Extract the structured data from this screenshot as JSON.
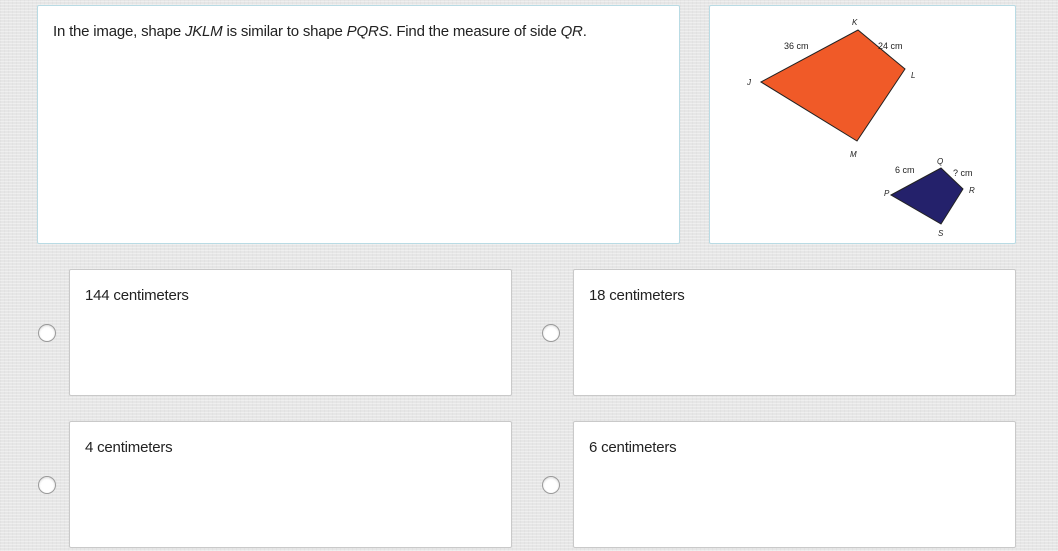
{
  "question": {
    "prefix": "In the image, shape ",
    "shape1": "JKLM",
    "middle": " is similar to shape ",
    "shape2": "PQRS",
    "suffix": ". Find the measure of side ",
    "side": "QR",
    "end": "."
  },
  "figure": {
    "large_shape": {
      "fill": "#f05a28",
      "vertices": {
        "J": "J",
        "K": "K",
        "L": "L",
        "M": "M"
      },
      "side_jk": "36 cm",
      "side_kl": "24 cm"
    },
    "small_shape": {
      "fill": "#24216b",
      "vertices": {
        "P": "P",
        "Q": "Q",
        "R": "R",
        "S": "S"
      },
      "side_pq": "6 cm",
      "side_qr": "? cm"
    }
  },
  "choices": [
    {
      "label": "144 centimeters"
    },
    {
      "label": "18 centimeters"
    },
    {
      "label": "4 centimeters"
    },
    {
      "label": "6 centimeters"
    }
  ]
}
